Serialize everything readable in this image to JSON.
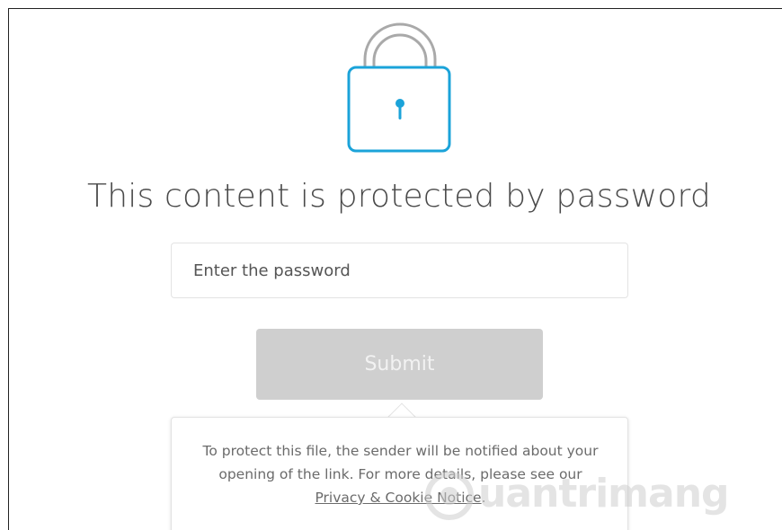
{
  "page": {
    "title": "This content is protected by password"
  },
  "password_field": {
    "placeholder": "Enter the password",
    "value": ""
  },
  "submit": {
    "label": "Submit"
  },
  "notice": {
    "text_before": "To protect this file, the sender will be notified about your opening of the link. For more details, please see our ",
    "link_label": "Privacy & Cookie Notice",
    "text_after": "."
  },
  "watermark": {
    "text": "uantrimang"
  },
  "icons": {
    "lock": "lock-icon"
  },
  "colors": {
    "lock_body": "#1ba3d9",
    "lock_shackle": "#a9a9a9",
    "button_disabled": "#cfcfcf",
    "title_text": "#4a4a4a"
  }
}
